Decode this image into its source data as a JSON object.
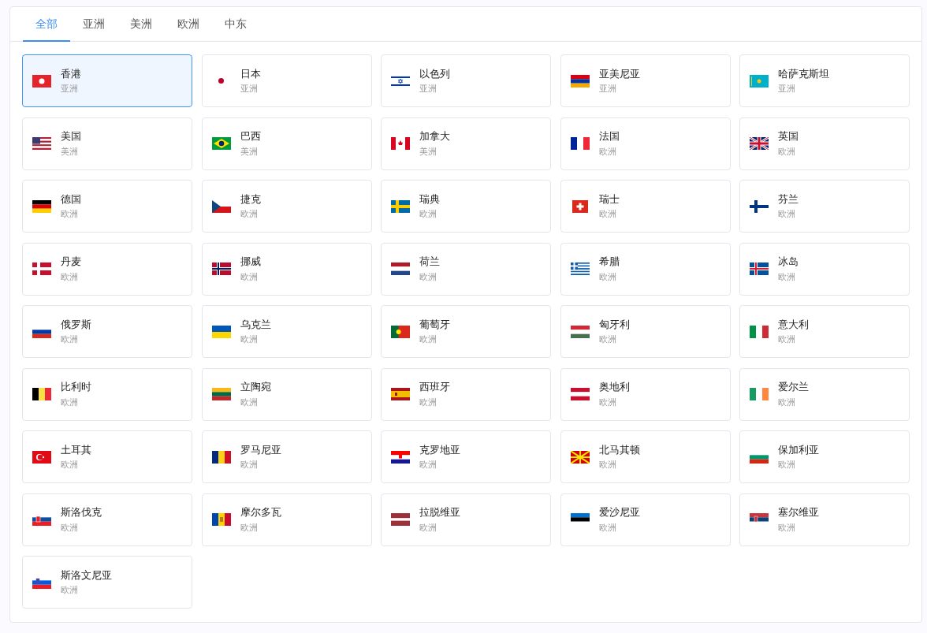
{
  "tabs": [
    {
      "label": "全部",
      "selected": true
    },
    {
      "label": "亚洲",
      "selected": false
    },
    {
      "label": "美洲",
      "selected": false
    },
    {
      "label": "欧洲",
      "selected": false
    },
    {
      "label": "中东",
      "selected": false
    }
  ],
  "countries": [
    {
      "name": "香港",
      "region": "亚洲",
      "kind": "hk",
      "selected": true
    },
    {
      "name": "日本",
      "region": "亚洲",
      "kind": "jp",
      "selected": false
    },
    {
      "name": "以色列",
      "region": "亚洲",
      "kind": "il",
      "selected": false
    },
    {
      "name": "亚美尼亚",
      "region": "亚洲",
      "kind": "am",
      "selected": false
    },
    {
      "name": "哈萨克斯坦",
      "region": "亚洲",
      "kind": "kz",
      "selected": false
    },
    {
      "name": "美国",
      "region": "美洲",
      "kind": "us",
      "selected": false
    },
    {
      "name": "巴西",
      "region": "美洲",
      "kind": "br",
      "selected": false
    },
    {
      "name": "加拿大",
      "region": "美洲",
      "kind": "ca",
      "selected": false
    },
    {
      "name": "法国",
      "region": "欧洲",
      "kind": "fr",
      "selected": false
    },
    {
      "name": "英国",
      "region": "欧洲",
      "kind": "gb",
      "selected": false
    },
    {
      "name": "德国",
      "region": "欧洲",
      "kind": "de",
      "selected": false
    },
    {
      "name": "捷克",
      "region": "欧洲",
      "kind": "cz",
      "selected": false
    },
    {
      "name": "瑞典",
      "region": "欧洲",
      "kind": "se",
      "selected": false
    },
    {
      "name": "瑞士",
      "region": "欧洲",
      "kind": "ch",
      "selected": false
    },
    {
      "name": "芬兰",
      "region": "欧洲",
      "kind": "fi",
      "selected": false
    },
    {
      "name": "丹麦",
      "region": "欧洲",
      "kind": "dk",
      "selected": false
    },
    {
      "name": "挪威",
      "region": "欧洲",
      "kind": "no",
      "selected": false
    },
    {
      "name": "荷兰",
      "region": "欧洲",
      "kind": "nl",
      "selected": false
    },
    {
      "name": "希腊",
      "region": "欧洲",
      "kind": "gr",
      "selected": false
    },
    {
      "name": "冰岛",
      "region": "欧洲",
      "kind": "is",
      "selected": false
    },
    {
      "name": "俄罗斯",
      "region": "欧洲",
      "kind": "ru",
      "selected": false
    },
    {
      "name": "乌克兰",
      "region": "欧洲",
      "kind": "ua",
      "selected": false
    },
    {
      "name": "葡萄牙",
      "region": "欧洲",
      "kind": "pt",
      "selected": false
    },
    {
      "name": "匈牙利",
      "region": "欧洲",
      "kind": "hu",
      "selected": false
    },
    {
      "name": "意大利",
      "region": "欧洲",
      "kind": "it",
      "selected": false
    },
    {
      "name": "比利时",
      "region": "欧洲",
      "kind": "be",
      "selected": false
    },
    {
      "name": "立陶宛",
      "region": "欧洲",
      "kind": "lt",
      "selected": false
    },
    {
      "name": "西班牙",
      "region": "欧洲",
      "kind": "es",
      "selected": false
    },
    {
      "name": "奥地利",
      "region": "欧洲",
      "kind": "at",
      "selected": false
    },
    {
      "name": "爱尔兰",
      "region": "欧洲",
      "kind": "ie",
      "selected": false
    },
    {
      "name": "土耳其",
      "region": "欧洲",
      "kind": "tr",
      "selected": false
    },
    {
      "name": "罗马尼亚",
      "region": "欧洲",
      "kind": "ro",
      "selected": false
    },
    {
      "name": "克罗地亚",
      "region": "欧洲",
      "kind": "hr",
      "selected": false
    },
    {
      "name": "北马其顿",
      "region": "欧洲",
      "kind": "mk",
      "selected": false
    },
    {
      "name": "保加利亚",
      "region": "欧洲",
      "kind": "bg",
      "selected": false
    },
    {
      "name": "斯洛伐克",
      "region": "欧洲",
      "kind": "sk",
      "selected": false
    },
    {
      "name": "摩尔多瓦",
      "region": "欧洲",
      "kind": "md",
      "selected": false
    },
    {
      "name": "拉脱维亚",
      "region": "欧洲",
      "kind": "lv",
      "selected": false
    },
    {
      "name": "爱沙尼亚",
      "region": "欧洲",
      "kind": "ee",
      "selected": false
    },
    {
      "name": "塞尔维亚",
      "region": "欧洲",
      "kind": "rs",
      "selected": false
    },
    {
      "name": "斯洛文尼亚",
      "region": "欧洲",
      "kind": "si",
      "selected": false
    }
  ]
}
